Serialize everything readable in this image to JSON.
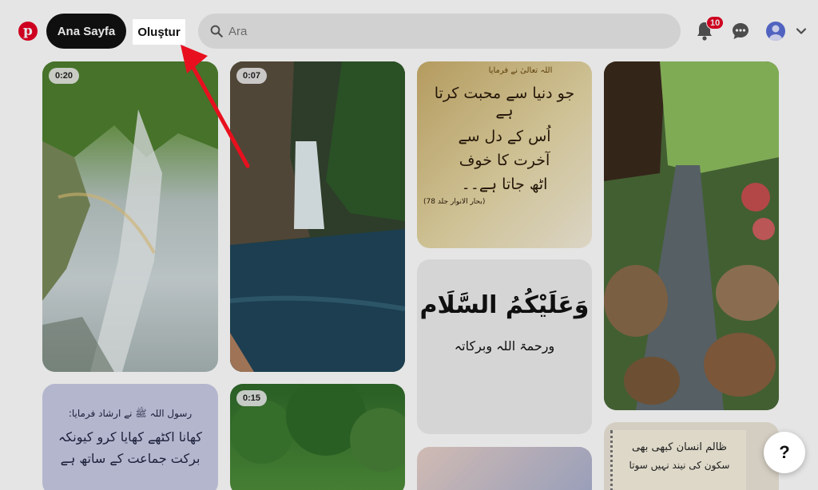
{
  "header": {
    "logo_letter": "p",
    "nav_home": "Ana Sayfa",
    "nav_create": "Oluştur",
    "search_placeholder": "Ara",
    "notification_count": "10"
  },
  "pins": [
    {
      "duration": "0:20"
    },
    {
      "duration": "0:07"
    },
    {
      "lines": [
        "اللہ تعالیٰ نے فرمایا",
        "جو دنیا سے محبت کرتا ہے",
        "اُس کے دل سے",
        "آخرت کا خوف",
        "اٹھ جاتا ہے۔۔"
      ],
      "footer": "(بحار الانوار جلد 78)"
    },
    {},
    {
      "lines": [
        "رسول اللہ ﷺ نے ارشاد فرمایا:",
        "کھانا اکٹھے کھایا کرو کیونکہ",
        "برکت جماعت کے ساتھ ہے"
      ]
    },
    {
      "duration": "0:15"
    },
    {
      "big": "وَعَلَيْكُمُ السَّلَام",
      "small": "ورحمۃ اللہ وبرکاتہ"
    },
    {
      "lines": [
        "ظالم انسان کبھی بھی",
        "سکون کی نیند نہیں سوتا"
      ]
    }
  ],
  "help_label": "?"
}
